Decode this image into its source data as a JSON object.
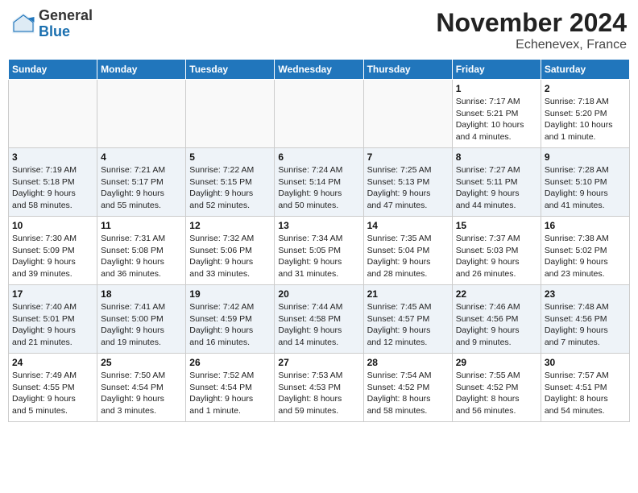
{
  "header": {
    "logo_general": "General",
    "logo_blue": "Blue",
    "month_title": "November 2024",
    "location": "Echenevex, France"
  },
  "weekdays": [
    "Sunday",
    "Monday",
    "Tuesday",
    "Wednesday",
    "Thursday",
    "Friday",
    "Saturday"
  ],
  "weeks": [
    [
      {
        "day": "",
        "info": ""
      },
      {
        "day": "",
        "info": ""
      },
      {
        "day": "",
        "info": ""
      },
      {
        "day": "",
        "info": ""
      },
      {
        "day": "",
        "info": ""
      },
      {
        "day": "1",
        "info": "Sunrise: 7:17 AM\nSunset: 5:21 PM\nDaylight: 10 hours\nand 4 minutes."
      },
      {
        "day": "2",
        "info": "Sunrise: 7:18 AM\nSunset: 5:20 PM\nDaylight: 10 hours\nand 1 minute."
      }
    ],
    [
      {
        "day": "3",
        "info": "Sunrise: 7:19 AM\nSunset: 5:18 PM\nDaylight: 9 hours\nand 58 minutes."
      },
      {
        "day": "4",
        "info": "Sunrise: 7:21 AM\nSunset: 5:17 PM\nDaylight: 9 hours\nand 55 minutes."
      },
      {
        "day": "5",
        "info": "Sunrise: 7:22 AM\nSunset: 5:15 PM\nDaylight: 9 hours\nand 52 minutes."
      },
      {
        "day": "6",
        "info": "Sunrise: 7:24 AM\nSunset: 5:14 PM\nDaylight: 9 hours\nand 50 minutes."
      },
      {
        "day": "7",
        "info": "Sunrise: 7:25 AM\nSunset: 5:13 PM\nDaylight: 9 hours\nand 47 minutes."
      },
      {
        "day": "8",
        "info": "Sunrise: 7:27 AM\nSunset: 5:11 PM\nDaylight: 9 hours\nand 44 minutes."
      },
      {
        "day": "9",
        "info": "Sunrise: 7:28 AM\nSunset: 5:10 PM\nDaylight: 9 hours\nand 41 minutes."
      }
    ],
    [
      {
        "day": "10",
        "info": "Sunrise: 7:30 AM\nSunset: 5:09 PM\nDaylight: 9 hours\nand 39 minutes."
      },
      {
        "day": "11",
        "info": "Sunrise: 7:31 AM\nSunset: 5:08 PM\nDaylight: 9 hours\nand 36 minutes."
      },
      {
        "day": "12",
        "info": "Sunrise: 7:32 AM\nSunset: 5:06 PM\nDaylight: 9 hours\nand 33 minutes."
      },
      {
        "day": "13",
        "info": "Sunrise: 7:34 AM\nSunset: 5:05 PM\nDaylight: 9 hours\nand 31 minutes."
      },
      {
        "day": "14",
        "info": "Sunrise: 7:35 AM\nSunset: 5:04 PM\nDaylight: 9 hours\nand 28 minutes."
      },
      {
        "day": "15",
        "info": "Sunrise: 7:37 AM\nSunset: 5:03 PM\nDaylight: 9 hours\nand 26 minutes."
      },
      {
        "day": "16",
        "info": "Sunrise: 7:38 AM\nSunset: 5:02 PM\nDaylight: 9 hours\nand 23 minutes."
      }
    ],
    [
      {
        "day": "17",
        "info": "Sunrise: 7:40 AM\nSunset: 5:01 PM\nDaylight: 9 hours\nand 21 minutes."
      },
      {
        "day": "18",
        "info": "Sunrise: 7:41 AM\nSunset: 5:00 PM\nDaylight: 9 hours\nand 19 minutes."
      },
      {
        "day": "19",
        "info": "Sunrise: 7:42 AM\nSunset: 4:59 PM\nDaylight: 9 hours\nand 16 minutes."
      },
      {
        "day": "20",
        "info": "Sunrise: 7:44 AM\nSunset: 4:58 PM\nDaylight: 9 hours\nand 14 minutes."
      },
      {
        "day": "21",
        "info": "Sunrise: 7:45 AM\nSunset: 4:57 PM\nDaylight: 9 hours\nand 12 minutes."
      },
      {
        "day": "22",
        "info": "Sunrise: 7:46 AM\nSunset: 4:56 PM\nDaylight: 9 hours\nand 9 minutes."
      },
      {
        "day": "23",
        "info": "Sunrise: 7:48 AM\nSunset: 4:56 PM\nDaylight: 9 hours\nand 7 minutes."
      }
    ],
    [
      {
        "day": "24",
        "info": "Sunrise: 7:49 AM\nSunset: 4:55 PM\nDaylight: 9 hours\nand 5 minutes."
      },
      {
        "day": "25",
        "info": "Sunrise: 7:50 AM\nSunset: 4:54 PM\nDaylight: 9 hours\nand 3 minutes."
      },
      {
        "day": "26",
        "info": "Sunrise: 7:52 AM\nSunset: 4:54 PM\nDaylight: 9 hours\nand 1 minute."
      },
      {
        "day": "27",
        "info": "Sunrise: 7:53 AM\nSunset: 4:53 PM\nDaylight: 8 hours\nand 59 minutes."
      },
      {
        "day": "28",
        "info": "Sunrise: 7:54 AM\nSunset: 4:52 PM\nDaylight: 8 hours\nand 58 minutes."
      },
      {
        "day": "29",
        "info": "Sunrise: 7:55 AM\nSunset: 4:52 PM\nDaylight: 8 hours\nand 56 minutes."
      },
      {
        "day": "30",
        "info": "Sunrise: 7:57 AM\nSunset: 4:51 PM\nDaylight: 8 hours\nand 54 minutes."
      }
    ]
  ]
}
